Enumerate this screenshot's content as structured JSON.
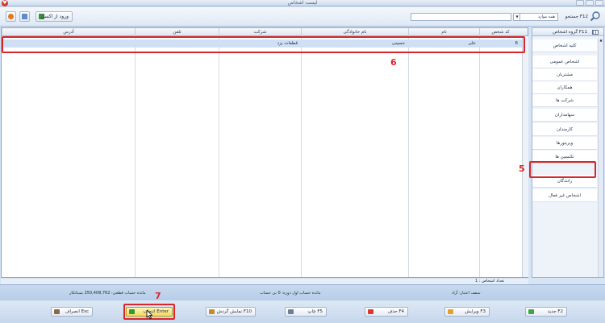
{
  "window": {
    "title": "لیست اشخاص"
  },
  "toolbar": {
    "excel_label": "ورود از اکسل",
    "search_label": "جستجو F12",
    "search_scope": "همه موارد",
    "search_value": ""
  },
  "grid": {
    "columns": [
      "کد شخص",
      "نام",
      "نام خانوادگی",
      "شرکت",
      "تلفن",
      "آدرس"
    ],
    "rows": [
      {
        "marker": "1",
        "code": "6",
        "first_name": "علی",
        "last_name": "حسینی",
        "company": "قطعات یزد",
        "phone": "",
        "address": ""
      }
    ]
  },
  "annotations": {
    "row_callout": "6",
    "sidebar_callout": "5",
    "select_callout": "7"
  },
  "sidebar": {
    "header": "گروه اشخاص F11",
    "items": [
      "کلیه اشخاص",
      "اشخاص عمومی",
      "مشتریان",
      "همکاران",
      "شرکت ها",
      "سهامداران",
      "کارمندان",
      "ویزیتورها",
      "تکنسین ها",
      "رانندگان",
      "اشخاص غیر فعال"
    ]
  },
  "status": {
    "count_label": "تعداد اشخاص : 1",
    "credit_limit": "سقف اعتبار: آزاد",
    "opening_balance": "مانده حساب اول دوره: 0 بی حساب",
    "final_balance": "مانده حساب قطعی: 250,408,762 بستانکار"
  },
  "buttons": {
    "new": "جدید F2",
    "edit": "ویرایش F3",
    "delete": "حذف F4",
    "print": "چاپ F5",
    "turnover": "نمایش گردش F10",
    "select": "انتخاب Enter",
    "cancel": "انصراف Esc"
  },
  "colors": {
    "highlight": "#d8262a",
    "selected_row": "#cfe0f5",
    "accent": "#2f6db5"
  }
}
